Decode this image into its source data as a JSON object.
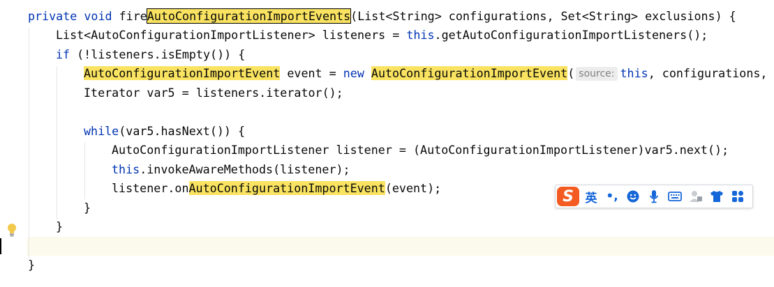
{
  "code": {
    "line1": {
      "kw1": "private",
      "kw2": "void",
      "name_pre": "fire",
      "name_hl": "AutoConfigurationImportEvents",
      "rest": "(List<String> configurations, Set<String> exclusions) {"
    },
    "line2": {
      "decl": "List<AutoConfigurationImportListener> listeners = ",
      "kw_this": "this",
      "rest": ".getAutoConfigurationImportListeners();"
    },
    "line3": {
      "kw_if": "if",
      "rest": " (!listeners.isEmpty()) {"
    },
    "line4": {
      "type_hl": "AutoConfigurationImportEvent",
      "mid": " event = ",
      "kw_new": "new",
      "ctor_hl": "AutoConfigurationImportEvent",
      "paren": "(",
      "hint": "source:",
      "kw_this": "this",
      "rest": ", configurations, "
    },
    "line5": {
      "text": "Iterator var5 = listeners.iterator();"
    },
    "line7": {
      "kw_while": "while",
      "rest": "(var5.hasNext()) {"
    },
    "line8": {
      "text": "AutoConfigurationImportListener listener = (AutoConfigurationImportListener)var5.next();"
    },
    "line9": {
      "kw_this": "this",
      "rest": ".invokeAwareMethods(listener);"
    },
    "line10": {
      "pre": "listener.on",
      "hl": "AutoConfigurationImportEvent",
      "post": "(event);"
    },
    "line11": {
      "text": "}"
    },
    "line12": {
      "text": "}"
    },
    "line14": {
      "text": "}"
    }
  },
  "ime": {
    "logo": "S",
    "lang": "英",
    "punct": "•,",
    "emoji_icon": "smiley-icon",
    "mic_icon": "microphone-icon",
    "keyboard_icon": "keyboard-icon",
    "user_icon": "user-icon",
    "skin_icon": "tshirt-icon",
    "apps_icon": "apps-grid-icon"
  },
  "colors": {
    "keyword": "#0033b3",
    "highlight": "#f9e361",
    "ime_accent": "#1566d8",
    "ime_logo": "#f35b22"
  }
}
